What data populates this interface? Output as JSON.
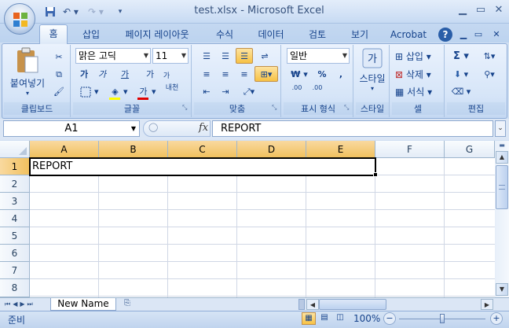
{
  "window": {
    "title": "test.xlsx - Microsoft Excel"
  },
  "qat": {
    "undo_icon": "undo-icon",
    "redo_icon": "redo-icon",
    "save_icon": "save-icon"
  },
  "tabs": [
    "홈",
    "삽입",
    "페이지 레이아웃",
    "수식",
    "데이터",
    "검토",
    "보기",
    "Acrobat"
  ],
  "ribbon": {
    "clipboard": {
      "paste": "붙여넣기",
      "label": "클립보드"
    },
    "font": {
      "name": "맑은 고딕",
      "size": "11",
      "label": "글꼴",
      "bold": "가",
      "italic": "가",
      "underline": "가",
      "grow": "가",
      "shrink": "가",
      "phonetic": "내천",
      "font_color_char": "가"
    },
    "alignment": {
      "label": "맞춤"
    },
    "number": {
      "format": "일반",
      "currency": "₩",
      "percent": "%",
      "comma": ",",
      "inc_decimal": ".00",
      "dec_decimal": ".00",
      "label": "표시 형식"
    },
    "styles": {
      "label": "스타일",
      "style_btn": "스타일"
    },
    "cells": {
      "insert": "삽입",
      "delete": "삭제",
      "format": "서식",
      "label": "셀"
    },
    "editing": {
      "label": "편집",
      "sum": "Σ"
    }
  },
  "formula_bar": {
    "name_box": "A1",
    "fx": "fx",
    "value": "REPORT"
  },
  "columns": [
    "A",
    "B",
    "C",
    "D",
    "E",
    "F",
    "G"
  ],
  "rows": [
    "1",
    "2",
    "3",
    "4",
    "5",
    "6",
    "7",
    "8"
  ],
  "cells": {
    "A1": "REPORT"
  },
  "sheets": {
    "active": "New Name"
  },
  "status": {
    "text": "준비",
    "zoom": "100%"
  }
}
